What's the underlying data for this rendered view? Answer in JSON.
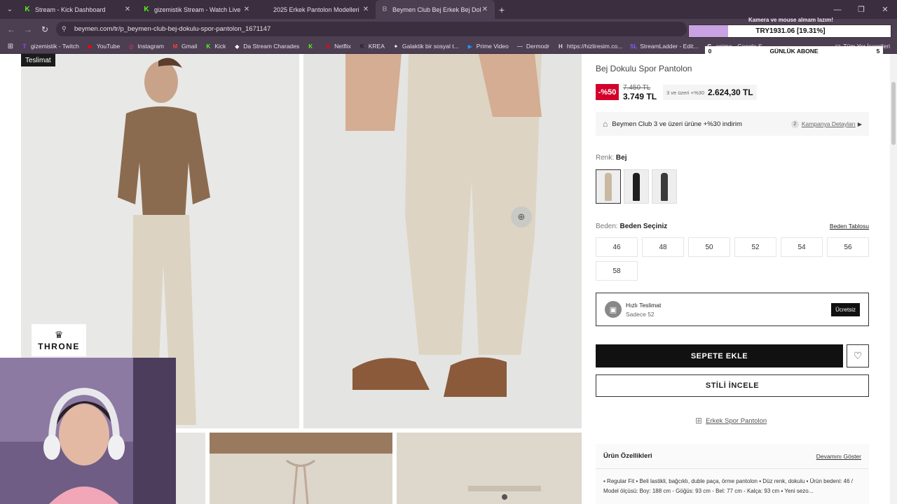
{
  "browser": {
    "tabs": [
      {
        "title": "Stream - Kick Dashboard",
        "icon": "K",
        "color": "#53fc18",
        "active": false
      },
      {
        "title": "gizemistik Stream - Watch Live",
        "icon": "K",
        "color": "#53fc18",
        "active": false
      },
      {
        "title": "2025 Erkek Pantolon Modelleri",
        "icon": "",
        "color": "#888888",
        "active": false
      },
      {
        "title": "Beymen Club Bej Erkek Bej Dok",
        "icon": "B",
        "color": "#888888",
        "active": true
      }
    ],
    "url": "beymen.com/tr/p_beymen-club-bej-dokulu-spor-pantolon_1671147",
    "bookmarks": [
      {
        "label": "gizemistik - Twitch",
        "icon": "T",
        "color": "#9146ff"
      },
      {
        "label": "YouTube",
        "icon": "▶",
        "color": "#ff0000"
      },
      {
        "label": "Instagram",
        "icon": "◎",
        "color": "#e1306c"
      },
      {
        "label": "Gmail",
        "icon": "M",
        "color": "#ea4335"
      },
      {
        "label": "Kick",
        "icon": "K",
        "color": "#53fc18"
      },
      {
        "label": "Da Stream Charades",
        "icon": "◆",
        "color": "#ffffff"
      },
      {
        "label": "",
        "icon": "K",
        "color": "#53fc18"
      },
      {
        "label": "Netflix",
        "icon": "N",
        "color": "#e50914"
      },
      {
        "label": "KREA",
        "icon": "K",
        "color": "#222222"
      },
      {
        "label": "Galaktik bir sosyal t...",
        "icon": "✦",
        "color": "#ffffff"
      },
      {
        "label": "Prime Video",
        "icon": "▶",
        "color": "#1a98ff"
      },
      {
        "label": "Dermodr",
        "icon": "—",
        "color": "#c8a2e3"
      },
      {
        "label": "https://hizliresim.co...",
        "icon": "H",
        "color": "#dddddd"
      },
      {
        "label": "StreamLadder - Edit...",
        "icon": "SL",
        "color": "#7b61ff"
      },
      {
        "label": "anime - Google S...",
        "icon": "G",
        "color": "#ffffff"
      }
    ],
    "all_bookmarks": "Tüm Yer İşaretleri"
  },
  "product": {
    "title": "Bej Dokulu Spor Pantolon",
    "discount": "-%50",
    "old_price": "7.450 TL",
    "price": "3.749 TL",
    "bulk_label": "3 ve üzeri +%30",
    "bulk_price": "2.624,30 TL",
    "promo_text": "Beymen Club 3 ve üzeri ürüne +%30 indirim",
    "promo_count": "2",
    "promo_link": "Kampanya Detayları",
    "color_label": "Renk:",
    "color_value": "Bej",
    "swatches": [
      {
        "color": "#c9b9a2",
        "active": true
      },
      {
        "color": "#1e1e1e",
        "active": false
      },
      {
        "color": "#3a3a3a",
        "active": false
      }
    ],
    "size_label": "Beden:",
    "size_value": "Beden Seçiniz",
    "size_table": "Beden Tablosu",
    "sizes": [
      "46",
      "48",
      "50",
      "52",
      "54",
      "56",
      "58"
    ],
    "ship_title": "Hızlı Teslimat",
    "ship_sub": "Sadece 52",
    "ship_badge": "Ücretsiz",
    "add_to_cart": "SEPETE EKLE",
    "style_btn": "STİLİ İNCELE",
    "category_link": "Erkek Spor Pantolon",
    "features_title": "Ürün Özellikleri",
    "features_more": "Devamını Göster",
    "features_text": "▪ Regular Fit   ▪ Beli lastikli, bağcıklı, duble paça, örme pantolon   ▪ Düz renk, dokulu   ▪ Ürün bedeni: 46 / Model ölçüsü: Boy: 188 cm - Göğüs: 93 cm - Bel: 77 cm - Kalça: 93 cm   ▪ Yeni sezo..."
  },
  "gallery": {
    "badge": "Teslimat"
  },
  "overlay": {
    "top_text": "Kamera ve mouse almam lazım!",
    "goal_text": "TRY1931.06 [19.31%]",
    "goal_progress": 0.1931,
    "sub_left": "0",
    "sub_label": "GÜNLÜK ABONE",
    "sub_right": "5",
    "logo_text": "THRONE"
  }
}
